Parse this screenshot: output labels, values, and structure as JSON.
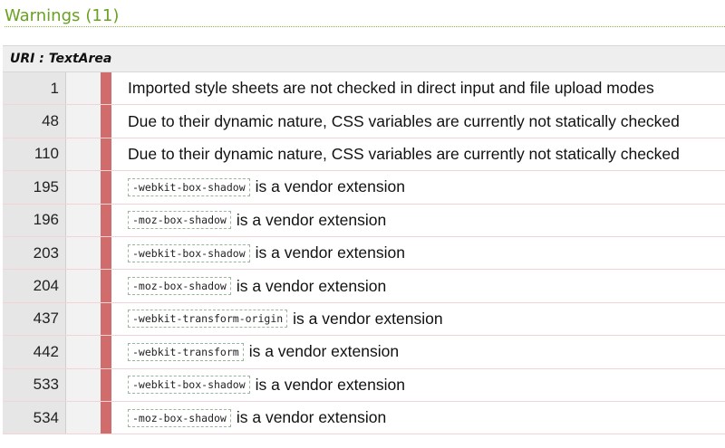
{
  "warnings": {
    "title": "Warnings",
    "count": "(11)"
  },
  "uri_header": "URI : TextArea",
  "rows": [
    {
      "line": "1",
      "code": "",
      "message": "Imported style sheets are not checked in direct input and file upload modes"
    },
    {
      "line": "48",
      "code": "",
      "message": "Due to their dynamic nature, CSS variables are currently not statically checked"
    },
    {
      "line": "110",
      "code": "",
      "message": "Due to their dynamic nature, CSS variables are currently not statically checked"
    },
    {
      "line": "195",
      "code": "-webkit-box-shadow",
      "message": "is a vendor extension"
    },
    {
      "line": "196",
      "code": "-moz-box-shadow",
      "message": "is a vendor extension"
    },
    {
      "line": "203",
      "code": "-webkit-box-shadow",
      "message": "is a vendor extension"
    },
    {
      "line": "204",
      "code": "-moz-box-shadow",
      "message": "is a vendor extension"
    },
    {
      "line": "437",
      "code": "-webkit-transform-origin",
      "message": "is a vendor extension"
    },
    {
      "line": "442",
      "code": "-webkit-transform",
      "message": "is a vendor extension"
    },
    {
      "line": "533",
      "code": "-webkit-box-shadow",
      "message": "is a vendor extension"
    },
    {
      "line": "534",
      "code": "-moz-box-shadow",
      "message": "is a vendor extension"
    }
  ],
  "colors": {
    "title_green": "#6aa121",
    "warning_bar": "#d06c6c",
    "line_cell_bg": "#e6e6e6"
  }
}
